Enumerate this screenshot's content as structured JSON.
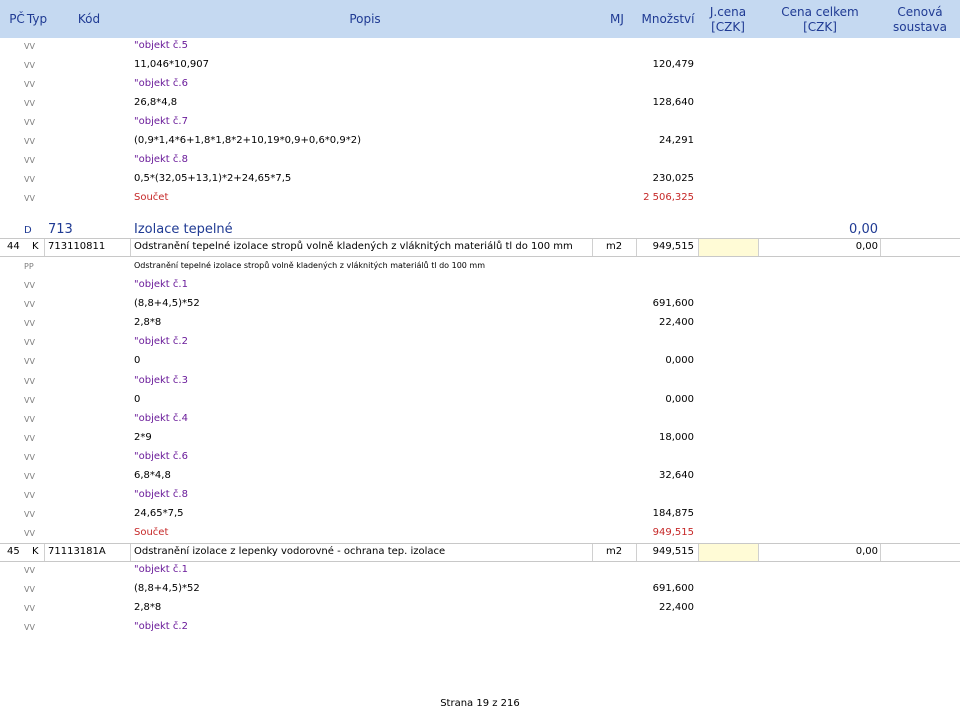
{
  "header": {
    "pc": "PČ",
    "typ": "Typ",
    "kod": "Kód",
    "popis": "Popis",
    "mj": "MJ",
    "mnozstvi": "Množství",
    "jcena_1": "J.cena",
    "jcena_2": "[CZK]",
    "cena_celkem_1": "Cena celkem",
    "cena_celkem_2": "[CZK]",
    "cenova_1": "Cenová",
    "cenova_2": "soustava"
  },
  "rows_top": [
    {
      "typ": "VV",
      "text": "\"objekt č.5",
      "kind": "label",
      "qty": ""
    },
    {
      "typ": "VV",
      "text": "11,046*10,907",
      "kind": "formula",
      "qty": "120,479"
    },
    {
      "typ": "VV",
      "text": "\"objekt č.6",
      "kind": "label",
      "qty": ""
    },
    {
      "typ": "VV",
      "text": "26,8*4,8",
      "kind": "formula",
      "qty": "128,640"
    },
    {
      "typ": "VV",
      "text": "\"objekt č.7",
      "kind": "label",
      "qty": ""
    },
    {
      "typ": "VV",
      "text": "(0,9*1,4*6+1,8*1,8*2+10,19*0,9+0,6*0,9*2)",
      "kind": "formula",
      "qty": "24,291"
    },
    {
      "typ": "VV",
      "text": "\"objekt č.8",
      "kind": "label",
      "qty": ""
    },
    {
      "typ": "VV",
      "text": "0,5*(32,05+13,1)*2+24,65*7,5",
      "kind": "formula",
      "qty": "230,025"
    },
    {
      "typ": "VV",
      "text": "Součet",
      "kind": "sum",
      "qty": "2 506,325"
    }
  ],
  "division": {
    "typ": "D",
    "code": "713",
    "name": "Izolace tepelné",
    "total": "0,00"
  },
  "item44": {
    "pc": "44",
    "typ": "K",
    "kod": "713110811",
    "popis": "Odstranění tepelné izolace stropů volně kladených z vláknitých materiálů tl do 100 mm",
    "mj": "m2",
    "qty": "949,515",
    "total": "0,00"
  },
  "pp44": {
    "typ": "PP",
    "text": "Odstranění tepelné izolace stropů volně kladených z vláknitých materiálů tl do 100 mm"
  },
  "rows_mid": [
    {
      "typ": "VV",
      "text": "\"objekt č.1",
      "kind": "label",
      "qty": ""
    },
    {
      "typ": "VV",
      "text": "(8,8+4,5)*52",
      "kind": "formula",
      "qty": "691,600"
    },
    {
      "typ": "VV",
      "text": "2,8*8",
      "kind": "formula",
      "qty": "22,400"
    },
    {
      "typ": "VV",
      "text": "\"objekt č.2",
      "kind": "label",
      "qty": ""
    },
    {
      "typ": "VV",
      "text": "0",
      "kind": "formula",
      "qty": "0,000"
    },
    {
      "typ": "VV",
      "text": "\"objekt č.3",
      "kind": "label",
      "qty": ""
    },
    {
      "typ": "VV",
      "text": "0",
      "kind": "formula",
      "qty": "0,000"
    },
    {
      "typ": "VV",
      "text": "\"objekt č.4",
      "kind": "label",
      "qty": ""
    },
    {
      "typ": "VV",
      "text": "2*9",
      "kind": "formula",
      "qty": "18,000"
    },
    {
      "typ": "VV",
      "text": "\"objekt č.6",
      "kind": "label",
      "qty": ""
    },
    {
      "typ": "VV",
      "text": "6,8*4,8",
      "kind": "formula",
      "qty": "32,640"
    },
    {
      "typ": "VV",
      "text": "\"objekt č.8",
      "kind": "label",
      "qty": ""
    },
    {
      "typ": "VV",
      "text": "24,65*7,5",
      "kind": "formula",
      "qty": "184,875"
    },
    {
      "typ": "VV",
      "text": "Součet",
      "kind": "sum",
      "qty": "949,515"
    }
  ],
  "item45": {
    "pc": "45",
    "typ": "K",
    "kod": "71113181A",
    "popis": "Odstranění izolace z lepenky vodorovné - ochrana tep. izolace",
    "mj": "m2",
    "qty": "949,515",
    "total": "0,00"
  },
  "rows_bottom": [
    {
      "typ": "VV",
      "text": "\"objekt č.1",
      "kind": "label",
      "qty": ""
    },
    {
      "typ": "VV",
      "text": "(8,8+4,5)*52",
      "kind": "formula",
      "qty": "691,600"
    },
    {
      "typ": "VV",
      "text": "2,8*8",
      "kind": "formula",
      "qty": "22,400"
    },
    {
      "typ": "VV",
      "text": "\"objekt č.2",
      "kind": "label",
      "qty": ""
    }
  ],
  "footer": {
    "page": "Strana 19 z 216"
  },
  "colors": {
    "header_bg": "#c5d9f1",
    "vv_gray": "#7f7f7f",
    "label_purple": "#6a1b9a",
    "sum_red": "#c62828",
    "price_cell": "#fffbd6"
  }
}
